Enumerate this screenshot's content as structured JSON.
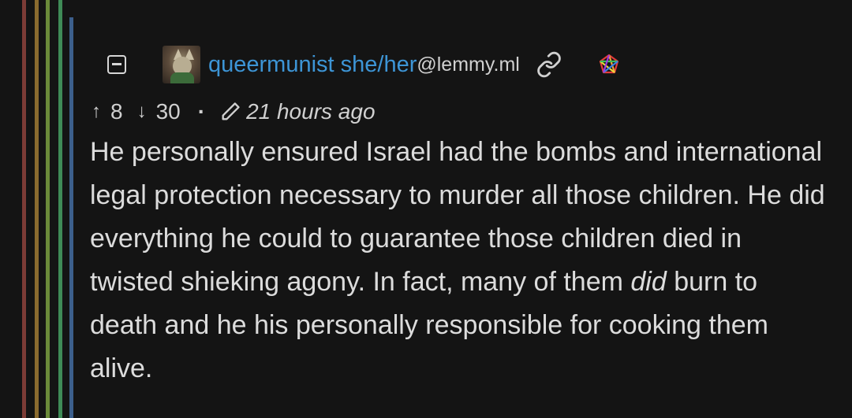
{
  "comment": {
    "author": {
      "username": "queermunist she/her",
      "instance": "@lemmy.ml"
    },
    "icons": {
      "collapse": "collapse-minus-icon",
      "avatar": "avatar-image",
      "link": "link-icon",
      "badge": "rainbow-star-badge-icon",
      "upvote": "arrow-up-icon",
      "downvote": "arrow-down-icon",
      "edited": "pencil-icon"
    },
    "upvote_arrow": "↑",
    "upvotes": "8",
    "downvote_arrow": "↓",
    "downvotes": "30",
    "separator": "·",
    "timestamp": "21 hours ago",
    "body": {
      "part1": "He personally ensured Israel had the bombs and international legal protection necessary to murder all those children. He did everything he could to guarantee those children died in twisted shieking agony. In fact, many of them ",
      "emphasis": "did",
      "part2": " burn to death and he his personally responsible for cooking them alive."
    }
  },
  "colors": {
    "background": "#141414",
    "username": "#3d95d6",
    "text": "#dcdcdc",
    "thread_lines": [
      "#7c3c36",
      "#8a6b2f",
      "#6b8a3a",
      "#3f8b57",
      "#3c5f8c"
    ]
  }
}
